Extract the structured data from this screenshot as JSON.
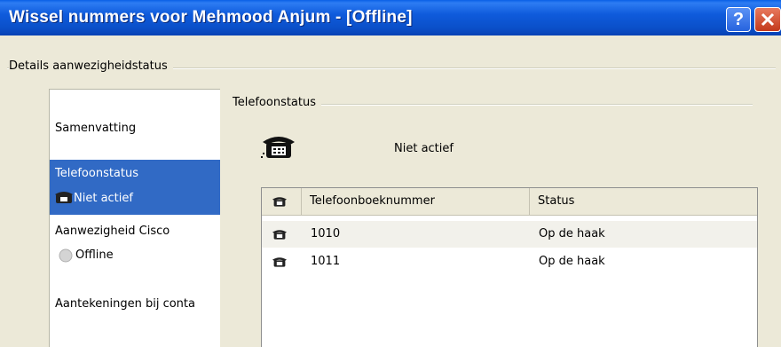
{
  "window": {
    "title": "Wissel nummers voor Mehmood Anjum - [Offline]",
    "help_label": "?",
    "close_label": "✕"
  },
  "details_group": {
    "label": "Details aanwezigheidstatus"
  },
  "nav": {
    "summary": "Samenvatting",
    "phone_status": {
      "label": "Telefoonstatus",
      "value": "Niet actief"
    },
    "presence": {
      "label": "Aanwezigheid Cisco",
      "value": "Offline"
    },
    "notes": "Aantekeningen bij conta"
  },
  "phone_group": {
    "label": "Telefoonstatus",
    "status_text": "Niet actief"
  },
  "table": {
    "columns": [
      "Telefoonboeknummer",
      "Status"
    ],
    "rows": [
      {
        "number": "1010",
        "status": "Op de haak"
      },
      {
        "number": "1011",
        "status": "Op de haak"
      }
    ]
  },
  "colors": {
    "title_bar": "#0A4FC8",
    "selection": "#316AC5",
    "dialog": "#ECE9D8"
  }
}
